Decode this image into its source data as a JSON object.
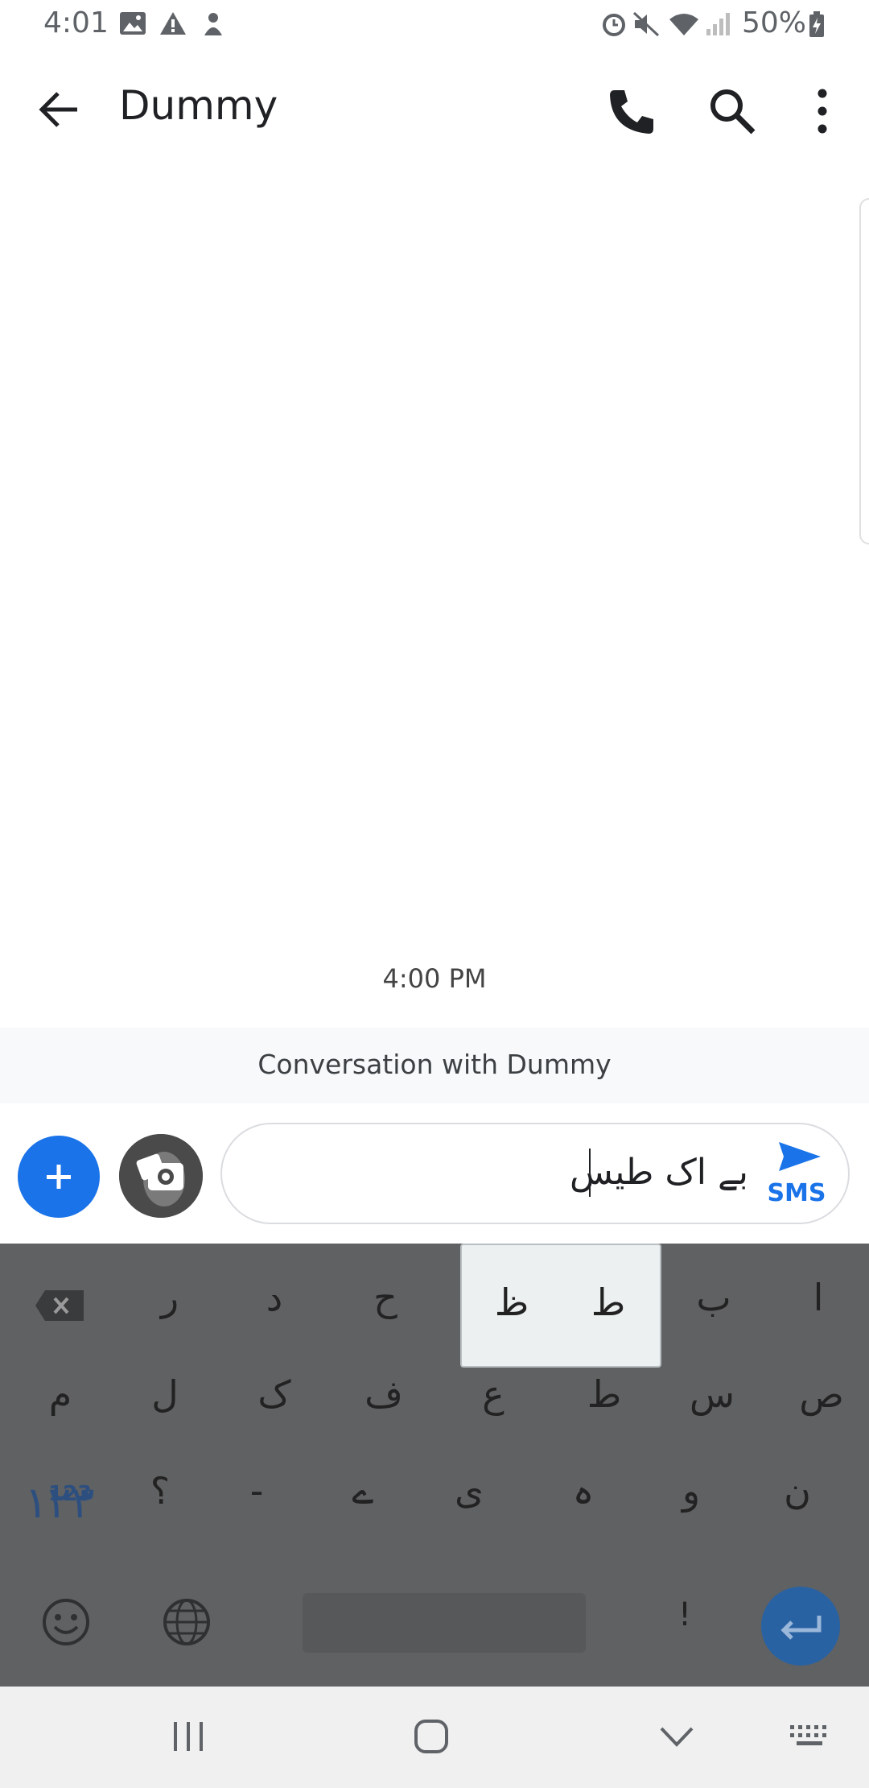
{
  "status_bar": {
    "time": "4:01",
    "battery": "50%",
    "icons": [
      "image-icon",
      "warning-icon",
      "notification-icon",
      "alarm-icon",
      "mute-icon",
      "wifi-icon",
      "signal-icon",
      "battery-charging-icon"
    ]
  },
  "app_bar": {
    "title": "Dummy",
    "icons": [
      "back-arrow-icon",
      "phone-icon",
      "search-icon",
      "more-vert-icon"
    ]
  },
  "conversation": {
    "timestamp": "4:00 PM",
    "banner": "Conversation with Dummy"
  },
  "compose": {
    "text": "بے اک طیس",
    "send_label": "SMS",
    "colors": {
      "accent": "#1a73e8"
    }
  },
  "keyboard": {
    "row1": [
      "ا",
      "ب",
      "ط",
      "ح",
      "د",
      "ر"
    ],
    "popup": [
      "ط",
      "ظ"
    ],
    "row2": [
      "ص",
      "س",
      "ط",
      "ع",
      "ف",
      "ک",
      "ل",
      "م"
    ],
    "row3": [
      "ن",
      "و",
      "ہ",
      "ی",
      "ے",
      "-",
      "؟"
    ],
    "number_key_top": "123",
    "number_key_bottom": "۱۲۳",
    "exclamation": "!"
  },
  "colors": {
    "keyboard_bg": "#5f6163",
    "enter": "#2962a3",
    "fab": "#1a73e8"
  }
}
